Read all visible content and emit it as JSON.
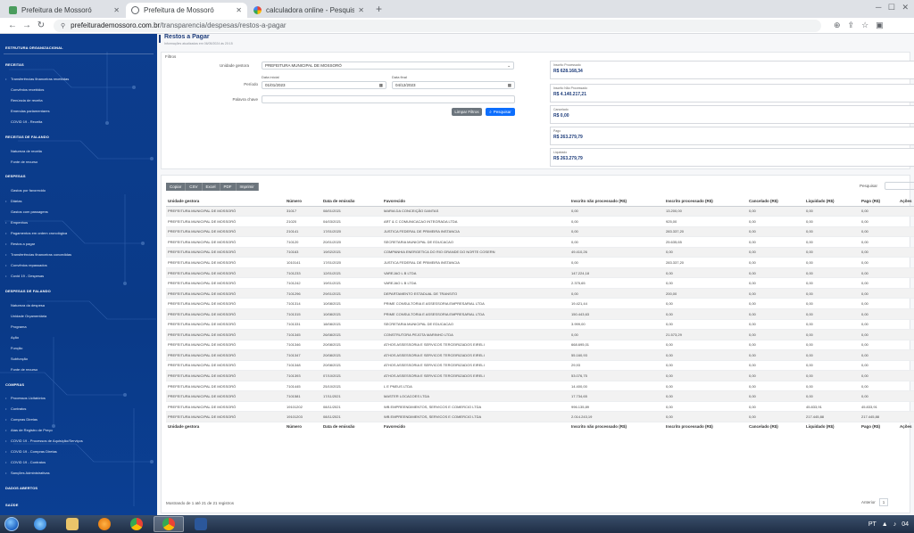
{
  "browser": {
    "tabs": [
      {
        "title": "Prefeitura de Mossoró",
        "active": false
      },
      {
        "title": "Prefeitura de Mossoró",
        "active": true
      },
      {
        "title": "calculadora online - Pesquisa Go",
        "active": false
      }
    ],
    "address_host": "prefeiturademossoro.com.br",
    "address_path": "/transparencia/despesas/restos-a-pagar"
  },
  "sidebar": {
    "sections": [
      {
        "label": "ESTRUTURA ORGANIZACIONAL"
      },
      {
        "label": "RECEITAS"
      },
      {
        "label": "RECEITAS DE FALANDO"
      },
      {
        "label": "DESPESAS"
      },
      {
        "label": "DESPESAS DE FALANDO"
      },
      {
        "label": "COMPRAS"
      },
      {
        "label": "DADOS ABERTOS"
      },
      {
        "label": "SAÚDE"
      }
    ],
    "items": [
      "Transferências financeiras recebidas",
      "Convênios recebidos",
      "Renúncia de receita",
      "Emendas parlamentares",
      "COVID 19 - Receita",
      "Natureza de receita",
      "Fonte de recurso",
      "Gastos por favorecido",
      "Diárias",
      "Gastos com passagens",
      "Empenhos",
      "Pagamentos em ordem cronológica",
      "Restos a pagar",
      "Transferências financeiras concedidas",
      "Convênios repassados",
      "Covid 19 - Despesas",
      "Natureza da despesa",
      "Unidade Orçamentária",
      "Programa",
      "Ação",
      "Função",
      "Subfunção",
      "Fonte de recurso",
      "Processos Licitatórios",
      "Contratos",
      "Compras Diretas",
      "Atas de Registro de Preço",
      "COVID 19 - Processos de Aquisição/Serviços",
      "COVID 19 - Compras Diretas",
      "COVID 19 - Contratos",
      "Sanções Administrativas"
    ]
  },
  "page": {
    "title": "Restos a Pagar",
    "updated": "Informações atualizadas em 06/05/2024 às 20:15"
  },
  "filters": {
    "card_label": "Filtros",
    "unidade_label": "Unidade gestora",
    "unidade_value": "PREFEITURA MUNICIPAL DE MOSSORÓ",
    "periodo_label": "Período",
    "data_inicial_label": "Data inicial",
    "data_inicial_value": "01/01/2023",
    "data_final_label": "Data final",
    "data_final_value": "04/12/2023",
    "palavra_label": "Palavra chave",
    "palavra_value": "",
    "limpar_label": "Limpar Filtros",
    "pesquisar_label": "Pesquisar"
  },
  "summary": [
    {
      "label": "Inscrito Processado",
      "value": "R$ 628.168,34"
    },
    {
      "label": "Inscrito Não Processado",
      "value": "R$ 4.140.217,21"
    },
    {
      "label": "Cancelado",
      "value": "R$ 0,00"
    },
    {
      "label": "Pago",
      "value": "R$ 263.279,79"
    },
    {
      "label": "Liquidado",
      "value": "R$ 263.279,79"
    }
  ],
  "table": {
    "export_buttons": [
      "Copiar",
      "CSV",
      "Excel",
      "PDF",
      "Imprimir"
    ],
    "search_label": "Pesquisar",
    "columns": [
      "Unidade gestora",
      "Número",
      "Data de emissão",
      "Favorecido",
      "Inscrito não processado (R$)",
      "Inscrito processado (R$)",
      "Cancelado (R$)",
      "Liquidado (R$)",
      "Pago (R$)",
      "Ações"
    ],
    "rows": [
      [
        "PREFEITURA MUNICIPAL DE MOSSORÓ",
        "31017",
        "08/01/2021",
        "MARIA DA CONCEIÇÃO DANTAS",
        "0,00",
        "13.200,00",
        "0,00",
        "0,00",
        "0,00"
      ],
      [
        "PREFEITURA MUNICIPAL DE MOSSORÓ",
        "21020",
        "04/03/2021",
        "ART & C COMUNICACAO INTEGRADA LTDA",
        "0,00",
        "925,00",
        "0,00",
        "0,00",
        "0,00"
      ],
      [
        "PREFEITURA MUNICIPAL DE MOSSORÓ",
        "210141",
        "17/01/2020",
        "JUSTICA FEDERAL DE PRIMEIRA INSTANCIA",
        "0,00",
        "283.337,20",
        "0,00",
        "0,00",
        "0,00"
      ],
      [
        "PREFEITURA MUNICIPAL DE MOSSORÓ",
        "710120",
        "20/01/2020",
        "SECRETARIA MUNICIPAL DE EDUCACAO",
        "0,00",
        "25.635,65",
        "0,00",
        "0,00",
        "0,00"
      ],
      [
        "PREFEITURA MUNICIPAL DE MOSSORÓ",
        "710163",
        "19/02/2021",
        "COMPANHIA ENERGETICA DO RIO GRANDE DO NORTE COSERN",
        "49.410,26",
        "0,00",
        "0,00",
        "0,00",
        "0,00"
      ],
      [
        "PREFEITURA MUNICIPAL DE MOSSORÓ",
        "1010141",
        "17/01/2020",
        "JUSTICA FEDERAL DE PRIMEIRA INSTANCIA",
        "0,00",
        "283.337,20",
        "0,00",
        "0,00",
        "0,00"
      ],
      [
        "PREFEITURA MUNICIPAL DE MOSSORÓ",
        "7101233",
        "12/01/2021",
        "VAREJAO L B LTDA",
        "147.224,18",
        "0,00",
        "0,00",
        "0,00",
        "0,00"
      ],
      [
        "PREFEITURA MUNICIPAL DE MOSSORÓ",
        "7101242",
        "19/01/2021",
        "VAREJAO L B LTDA",
        "2.375,65",
        "0,00",
        "0,00",
        "0,00",
        "0,00"
      ],
      [
        "PREFEITURA MUNICIPAL DE MOSSORÓ",
        "7101296",
        "29/01/2021",
        "DEPARTAMENTO ESTADUAL DE TRANSITO",
        "0,00",
        "200,00",
        "0,00",
        "0,00",
        "0,00"
      ],
      [
        "PREFEITURA MUNICIPAL DE MOSSORÓ",
        "7101314",
        "10/08/2021",
        "PRIME CONSULTORIA E ASSESSORIA EMPRESARIAL LTDA",
        "19.421,44",
        "0,00",
        "0,00",
        "0,00",
        "0,00"
      ],
      [
        "PREFEITURA MUNICIPAL DE MOSSORÓ",
        "7101315",
        "10/08/2021",
        "PRIME CONSULTORIA E ASSESSORIA EMPRESARIAL LTDA",
        "150.443,63",
        "0,00",
        "0,00",
        "0,00",
        "0,00"
      ],
      [
        "PREFEITURA MUNICIPAL DE MOSSORÓ",
        "7101331",
        "18/08/2021",
        "SECRETARIA MUNICIPAL DE EDUCACAO",
        "3.999,00",
        "0,00",
        "0,00",
        "0,00",
        "0,00"
      ],
      [
        "PREFEITURA MUNICIPAL DE MOSSORÓ",
        "7101345",
        "26/08/2021",
        "CONSTRUTORA PEJOTA MARINHO LTDA",
        "0,00",
        "21.573,29",
        "0,00",
        "0,00",
        "0,00"
      ],
      [
        "PREFEITURA MUNICIPAL DE MOSSORÓ",
        "7101346",
        "20/08/2021",
        "ATHOS ASSESSORIA E SERVICOS TERCEIRIZADOS EIRELI",
        "668.695,01",
        "0,00",
        "0,00",
        "0,00",
        "0,00"
      ],
      [
        "PREFEITURA MUNICIPAL DE MOSSORÓ",
        "7101347",
        "20/08/2021",
        "ATHOS ASSESSORIA E SERVICOS TERCEIRIZADOS EIRELI",
        "55.160,93",
        "0,00",
        "0,00",
        "0,00",
        "0,00"
      ],
      [
        "PREFEITURA MUNICIPAL DE MOSSORÓ",
        "7101348",
        "20/08/2021",
        "ATHOS ASSESSORIA E SERVICOS TERCEIRIZADOS EIRELI",
        "29,93",
        "0,00",
        "0,00",
        "0,00",
        "0,00"
      ],
      [
        "PREFEITURA MUNICIPAL DE MOSSORÓ",
        "7101393",
        "07/10/2021",
        "ATHOS ASSESSORIA E SERVICOS TERCEIRIZADOS EIRELI",
        "53.076,75",
        "0,00",
        "0,00",
        "0,00",
        "0,00"
      ],
      [
        "PREFEITURA MUNICIPAL DE MOSSORÓ",
        "7101445",
        "25/10/2021",
        "L E PNEUS LTDA",
        "14.400,00",
        "0,00",
        "0,00",
        "0,00",
        "0,00"
      ],
      [
        "PREFEITURA MUNICIPAL DE MOSSORÓ",
        "7101581",
        "17/11/2021",
        "MASTER LOCACOES LTDA",
        "17.734,65",
        "0,00",
        "0,00",
        "0,00",
        "0,00"
      ],
      [
        "PREFEITURA MUNICIPAL DE MOSSORÓ",
        "19101202",
        "08/11/2021",
        "WB EMPREENDIMENTOS, SERVICOS E COMERCIO LTDA",
        "996.135,89",
        "0,00",
        "0,00",
        "45.833,91",
        "45.833,91"
      ],
      [
        "PREFEITURA MUNICIPAL DE MOSSORÓ",
        "19101203",
        "08/11/2021",
        "WB EMPREENDIMENTOS, SERVICOS E COMERCIO LTDA",
        "2.014.243,19",
        "0,00",
        "0,00",
        "217.445,88",
        "217.445,88"
      ]
    ],
    "info": "Mostrando de 1 até 21 de 21 registros",
    "prev_label": "Anterior",
    "page_number": "1"
  },
  "taskbar": {
    "lang": "PT",
    "clock": "04"
  },
  "colors": {
    "sidebar": "#0c3d8e",
    "primary": "#0d6efd",
    "accent_title": "#1d3c7a"
  }
}
